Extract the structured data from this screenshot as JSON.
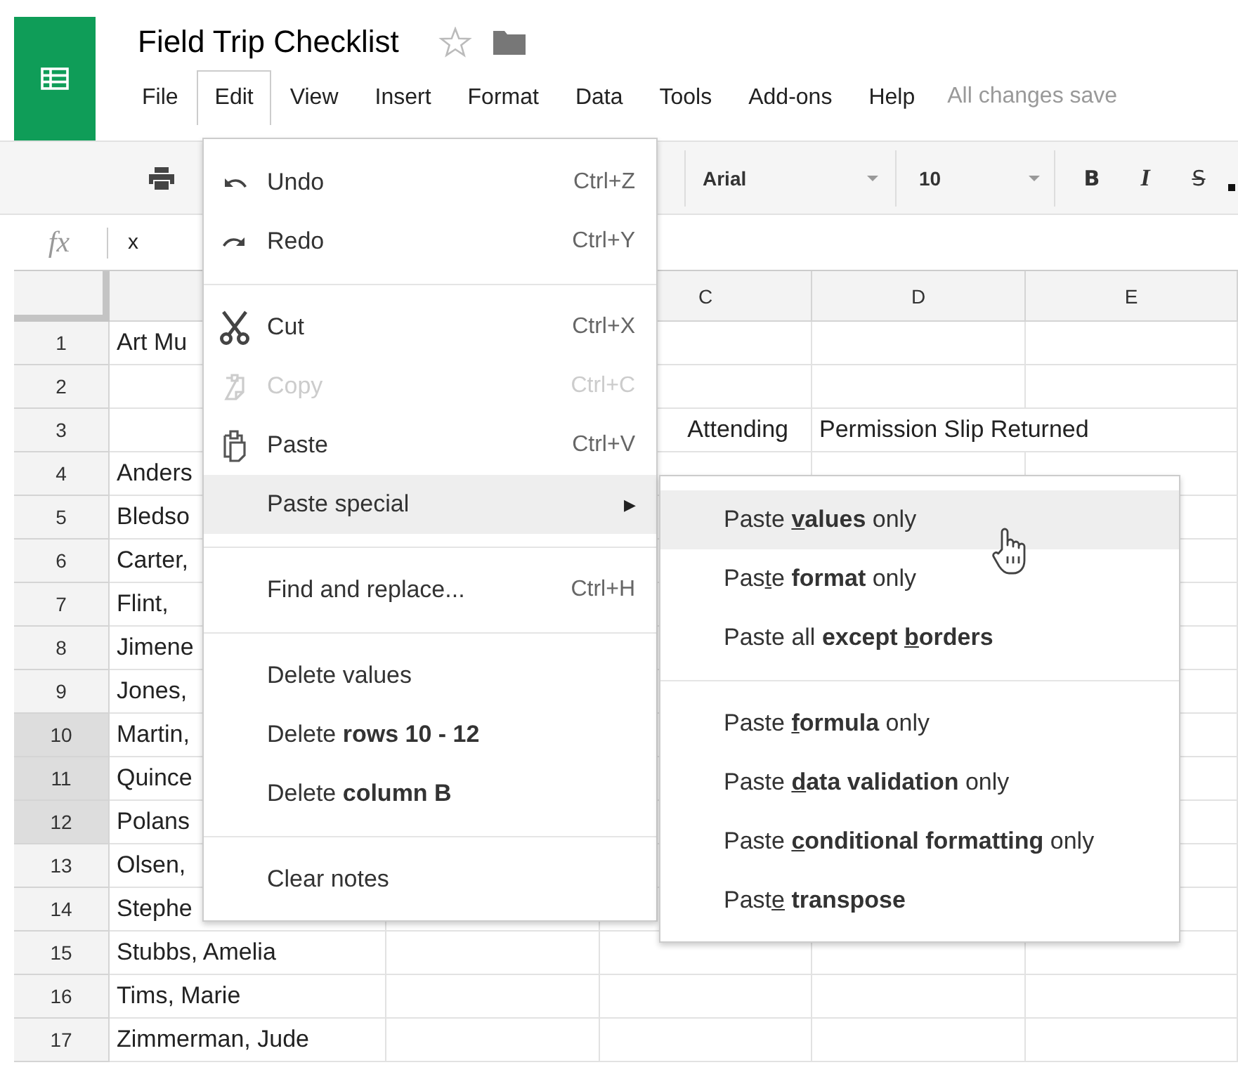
{
  "app": {
    "title": "Field Trip Checklist",
    "save_status": "All changes save"
  },
  "menubar": [
    {
      "label": "File",
      "selected": false
    },
    {
      "label": "Edit",
      "selected": true
    },
    {
      "label": "View",
      "selected": false
    },
    {
      "label": "Insert",
      "selected": false
    },
    {
      "label": "Format",
      "selected": false
    },
    {
      "label": "Data",
      "selected": false
    },
    {
      "label": "Tools",
      "selected": false
    },
    {
      "label": "Add-ons",
      "selected": false
    },
    {
      "label": "Help",
      "selected": false
    }
  ],
  "toolbar": {
    "font": "Arial",
    "font_size": "10",
    "format_buttons": [
      {
        "kind": "bold",
        "label": "B"
      },
      {
        "kind": "italic",
        "label": "I"
      },
      {
        "kind": "strike",
        "label": "S"
      }
    ]
  },
  "formula_bar": {
    "label": "fx",
    "value": "x"
  },
  "grid": {
    "column_headers": [
      "C",
      "D",
      "E"
    ],
    "rows": [
      {
        "number": "1",
        "selected": false,
        "cells": {
          "A": {
            "text": "Art Mu",
            "partial": false
          }
        }
      },
      {
        "number": "2",
        "selected": false,
        "cells": {}
      },
      {
        "number": "3",
        "selected": false,
        "cells": {
          "C": {
            "text": "Attending",
            "partial": true
          },
          "D": {
            "text": "Permission Slip Returned",
            "partial": false
          }
        }
      },
      {
        "number": "4",
        "selected": false,
        "cells": {
          "A": {
            "text": "Anders",
            "partial": false
          }
        }
      },
      {
        "number": "5",
        "selected": false,
        "cells": {
          "A": {
            "text": "Bledso",
            "partial": false
          }
        }
      },
      {
        "number": "6",
        "selected": false,
        "cells": {
          "A": {
            "text": "Carter,",
            "partial": false
          }
        }
      },
      {
        "number": "7",
        "selected": false,
        "cells": {
          "A": {
            "text": "Flint,",
            "partial": false
          }
        }
      },
      {
        "number": "8",
        "selected": false,
        "cells": {
          "A": {
            "text": "Jimene",
            "partial": false
          }
        }
      },
      {
        "number": "9",
        "selected": false,
        "cells": {
          "A": {
            "text": "Jones,",
            "partial": false
          }
        }
      },
      {
        "number": "10",
        "selected": true,
        "cells": {
          "A": {
            "text": "Martin,",
            "partial": false
          }
        }
      },
      {
        "number": "11",
        "selected": true,
        "cells": {
          "A": {
            "text": "Quince",
            "partial": false
          }
        }
      },
      {
        "number": "12",
        "selected": true,
        "cells": {
          "A": {
            "text": "Polans",
            "partial": false
          }
        }
      },
      {
        "number": "13",
        "selected": false,
        "cells": {
          "A": {
            "text": "Olsen,",
            "partial": false
          }
        }
      },
      {
        "number": "14",
        "selected": false,
        "cells": {
          "A": {
            "text": "Stephe",
            "partial": false
          }
        }
      },
      {
        "number": "15",
        "selected": false,
        "cells": {
          "A": {
            "text": "Stubbs, Amelia",
            "partial": false
          }
        }
      },
      {
        "number": "16",
        "selected": false,
        "cells": {
          "A": {
            "text": "Tims, Marie",
            "partial": false
          }
        }
      },
      {
        "number": "17",
        "selected": false,
        "cells": {
          "A": {
            "text": "Zimmerman, Jude",
            "partial": false
          }
        }
      }
    ]
  },
  "edit_menu": {
    "groups": [
      {
        "items": [
          {
            "kind": "item",
            "label": "Undo",
            "shortcut": "Ctrl+Z",
            "selected": false,
            "disabled": false
          },
          {
            "kind": "item",
            "label": "Redo",
            "shortcut": "Ctrl+Y",
            "selected": false,
            "disabled": false
          }
        ]
      },
      {
        "items": [
          {
            "kind": "item",
            "label": "Cut",
            "shortcut": "Ctrl+X",
            "selected": false,
            "disabled": false
          },
          {
            "kind": "item",
            "label": "Copy",
            "shortcut": "Ctrl+C",
            "selected": false,
            "disabled": true
          },
          {
            "kind": "item",
            "label": "Paste",
            "shortcut": "Ctrl+V",
            "selected": false,
            "disabled": false
          },
          {
            "kind": "submenu",
            "label": "Paste special",
            "arrow": "▶",
            "selected": true,
            "disabled": false
          }
        ]
      },
      {
        "items": [
          {
            "kind": "item",
            "label": "Find and replace...",
            "shortcut": "Ctrl+H",
            "selected": false,
            "disabled": false
          }
        ]
      },
      {
        "items": [
          {
            "kind": "item",
            "label": "Delete values",
            "selected": false,
            "disabled": false
          },
          {
            "kind": "item",
            "label": "Delete **rows 10 - 12**",
            "selected": false,
            "disabled": false
          },
          {
            "kind": "item",
            "label": "Delete **column B**",
            "selected": false,
            "disabled": false
          }
        ]
      },
      {
        "items": [
          {
            "kind": "item",
            "label": "Clear notes",
            "selected": false,
            "disabled": false
          }
        ]
      }
    ]
  },
  "paste_special_menu": {
    "groups": [
      {
        "items": [
          {
            "selected": true,
            "segments": [
              {
                "text": "Paste ",
                "bold": false,
                "underline": false
              },
              {
                "text": "v",
                "bold": true,
                "underline": true
              },
              {
                "text": "alues",
                "bold": true,
                "underline": false
              },
              {
                "text": " only",
                "bold": false,
                "underline": false
              }
            ]
          },
          {
            "selected": false,
            "segments": [
              {
                "text": "Pas",
                "bold": false,
                "underline": false
              },
              {
                "text": "t",
                "bold": false,
                "underline": true
              },
              {
                "text": "e ",
                "bold": false,
                "underline": false
              },
              {
                "text": "format",
                "bold": true,
                "underline": false
              },
              {
                "text": " only",
                "bold": false,
                "underline": false
              }
            ]
          },
          {
            "selected": false,
            "segments": [
              {
                "text": "Paste all ",
                "bold": false,
                "underline": false
              },
              {
                "text": "except ",
                "bold": true,
                "underline": false
              },
              {
                "text": "b",
                "bold": true,
                "underline": true
              },
              {
                "text": "orders",
                "bold": true,
                "underline": false
              }
            ]
          }
        ]
      },
      {
        "items": [
          {
            "selected": false,
            "segments": [
              {
                "text": "Paste ",
                "bold": false,
                "underline": false
              },
              {
                "text": "f",
                "bold": true,
                "underline": true
              },
              {
                "text": "ormula",
                "bold": true,
                "underline": false
              },
              {
                "text": " only",
                "bold": false,
                "underline": false
              }
            ]
          },
          {
            "selected": false,
            "segments": [
              {
                "text": "Paste ",
                "bold": false,
                "underline": false
              },
              {
                "text": "d",
                "bold": true,
                "underline": true
              },
              {
                "text": "ata validation",
                "bold": true,
                "underline": false
              },
              {
                "text": " only",
                "bold": false,
                "underline": false
              }
            ]
          },
          {
            "selected": false,
            "segments": [
              {
                "text": "Paste ",
                "bold": false,
                "underline": false
              },
              {
                "text": "c",
                "bold": true,
                "underline": true
              },
              {
                "text": "onditional formatting",
                "bold": true,
                "underline": false
              },
              {
                "text": " only",
                "bold": false,
                "underline": false
              }
            ]
          },
          {
            "selected": false,
            "segments": [
              {
                "text": "Past",
                "bold": false,
                "underline": false
              },
              {
                "text": "e",
                "bold": false,
                "underline": true
              },
              {
                "text": " transpose",
                "bold": true,
                "underline": false
              }
            ]
          }
        ]
      }
    ]
  }
}
